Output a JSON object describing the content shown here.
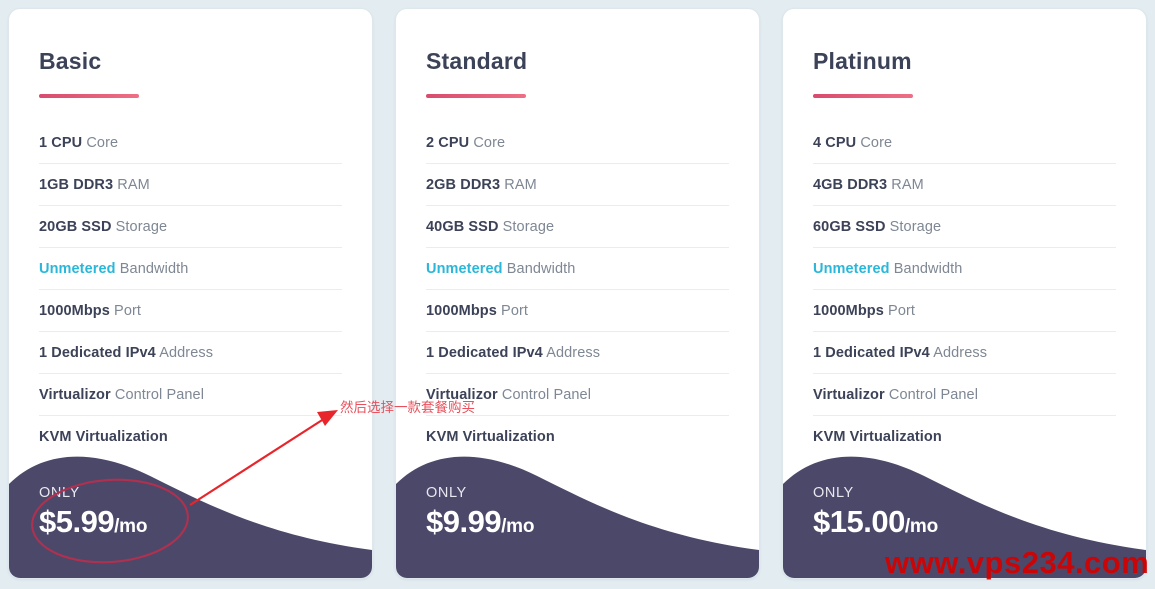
{
  "page": {
    "background_color": "#e2ecf1",
    "accent_color": "#d94b6e",
    "teal_color": "#2ab7d9",
    "footer_color": "#4c4869",
    "annotation_color": "#e8505b",
    "watermark_color": "#d40000"
  },
  "annotations": {
    "arrow_note": "然后选择一款套餐购买",
    "watermark": "www.vps234.com"
  },
  "labels": {
    "only": "ONLY",
    "per_month": "/mo"
  },
  "plans": [
    {
      "name": "Basic",
      "price": "$5.99",
      "per": "/mo",
      "features": [
        {
          "strong": "1 CPU",
          "rest": " Core"
        },
        {
          "strong": "1GB DDR3",
          "rest": " RAM"
        },
        {
          "strong": "20GB SSD",
          "rest": " Storage"
        },
        {
          "strong": "Unmetered",
          "rest": " Bandwidth"
        },
        {
          "strong": "1000Mbps",
          "rest": " Port"
        },
        {
          "strong": "1 Dedicated IPv4",
          "rest": " Address"
        },
        {
          "strong": "Virtualizor",
          "rest": " Control Panel"
        },
        {
          "strong": "KVM Virtualization",
          "rest": ""
        }
      ]
    },
    {
      "name": "Standard",
      "price": "$9.99",
      "per": "/mo",
      "features": [
        {
          "strong": "2 CPU",
          "rest": " Core"
        },
        {
          "strong": "2GB DDR3",
          "rest": " RAM"
        },
        {
          "strong": "40GB SSD",
          "rest": " Storage"
        },
        {
          "strong": "Unmetered",
          "rest": " Bandwidth"
        },
        {
          "strong": "1000Mbps",
          "rest": " Port"
        },
        {
          "strong": "1 Dedicated IPv4",
          "rest": " Address"
        },
        {
          "strong": "Virtualizor",
          "rest": " Control Panel"
        },
        {
          "strong": "KVM Virtualization",
          "rest": ""
        }
      ]
    },
    {
      "name": "Platinum",
      "price": "$15.00",
      "per": "/mo",
      "features": [
        {
          "strong": "4 CPU",
          "rest": " Core"
        },
        {
          "strong": "4GB DDR3",
          "rest": " RAM"
        },
        {
          "strong": "60GB SSD",
          "rest": " Storage"
        },
        {
          "strong": "Unmetered",
          "rest": " Bandwidth"
        },
        {
          "strong": "1000Mbps",
          "rest": " Port"
        },
        {
          "strong": "1 Dedicated IPv4",
          "rest": " Address"
        },
        {
          "strong": "Virtualizor",
          "rest": " Control Panel"
        },
        {
          "strong": "KVM Virtualization",
          "rest": ""
        }
      ]
    }
  ]
}
